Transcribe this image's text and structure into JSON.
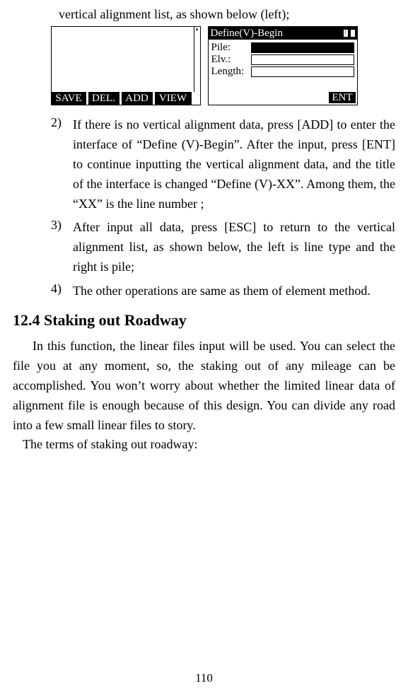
{
  "intro": "vertical alignment list, as shown below (left);",
  "leftPanel": {
    "buttons": {
      "save": "SAVE",
      "del": "DEL.",
      "add": "ADD",
      "view": "VIEW"
    }
  },
  "rightPanel": {
    "title": "Define(V)-Begin",
    "fields": {
      "pile": "Pile:",
      "elv": "Elv.:",
      "length": "Length:"
    },
    "ent": "ENT"
  },
  "items": {
    "n2": "2)",
    "t2": "If there is no vertical alignment data, press [ADD] to enter the interface of “Define (V)-Begin”. After the input, press [ENT] to continue inputting the vertical alignment data, and the title of the interface is changed “Define (V)-XX”. Among them, the “XX” is the line number ;",
    "n3": "3)",
    "t3": "After input all data, press [ESC] to return to the vertical alignment list, as shown below, the left is line type and the right is pile;",
    "n4": "4)",
    "t4": "The other operations are same as them of element method."
  },
  "heading": "12.4 Staking out Roadway",
  "para1": "In this function, the linear files input will be used. You can select the file you at any moment, so, the staking out of any mileage can be accomplished. You won’t worry about whether the limited linear data of alignment file is enough because of this design. You can divide any road into a few small linear files to story.",
  "para2": "The terms of staking out roadway:",
  "pageNum": "110"
}
